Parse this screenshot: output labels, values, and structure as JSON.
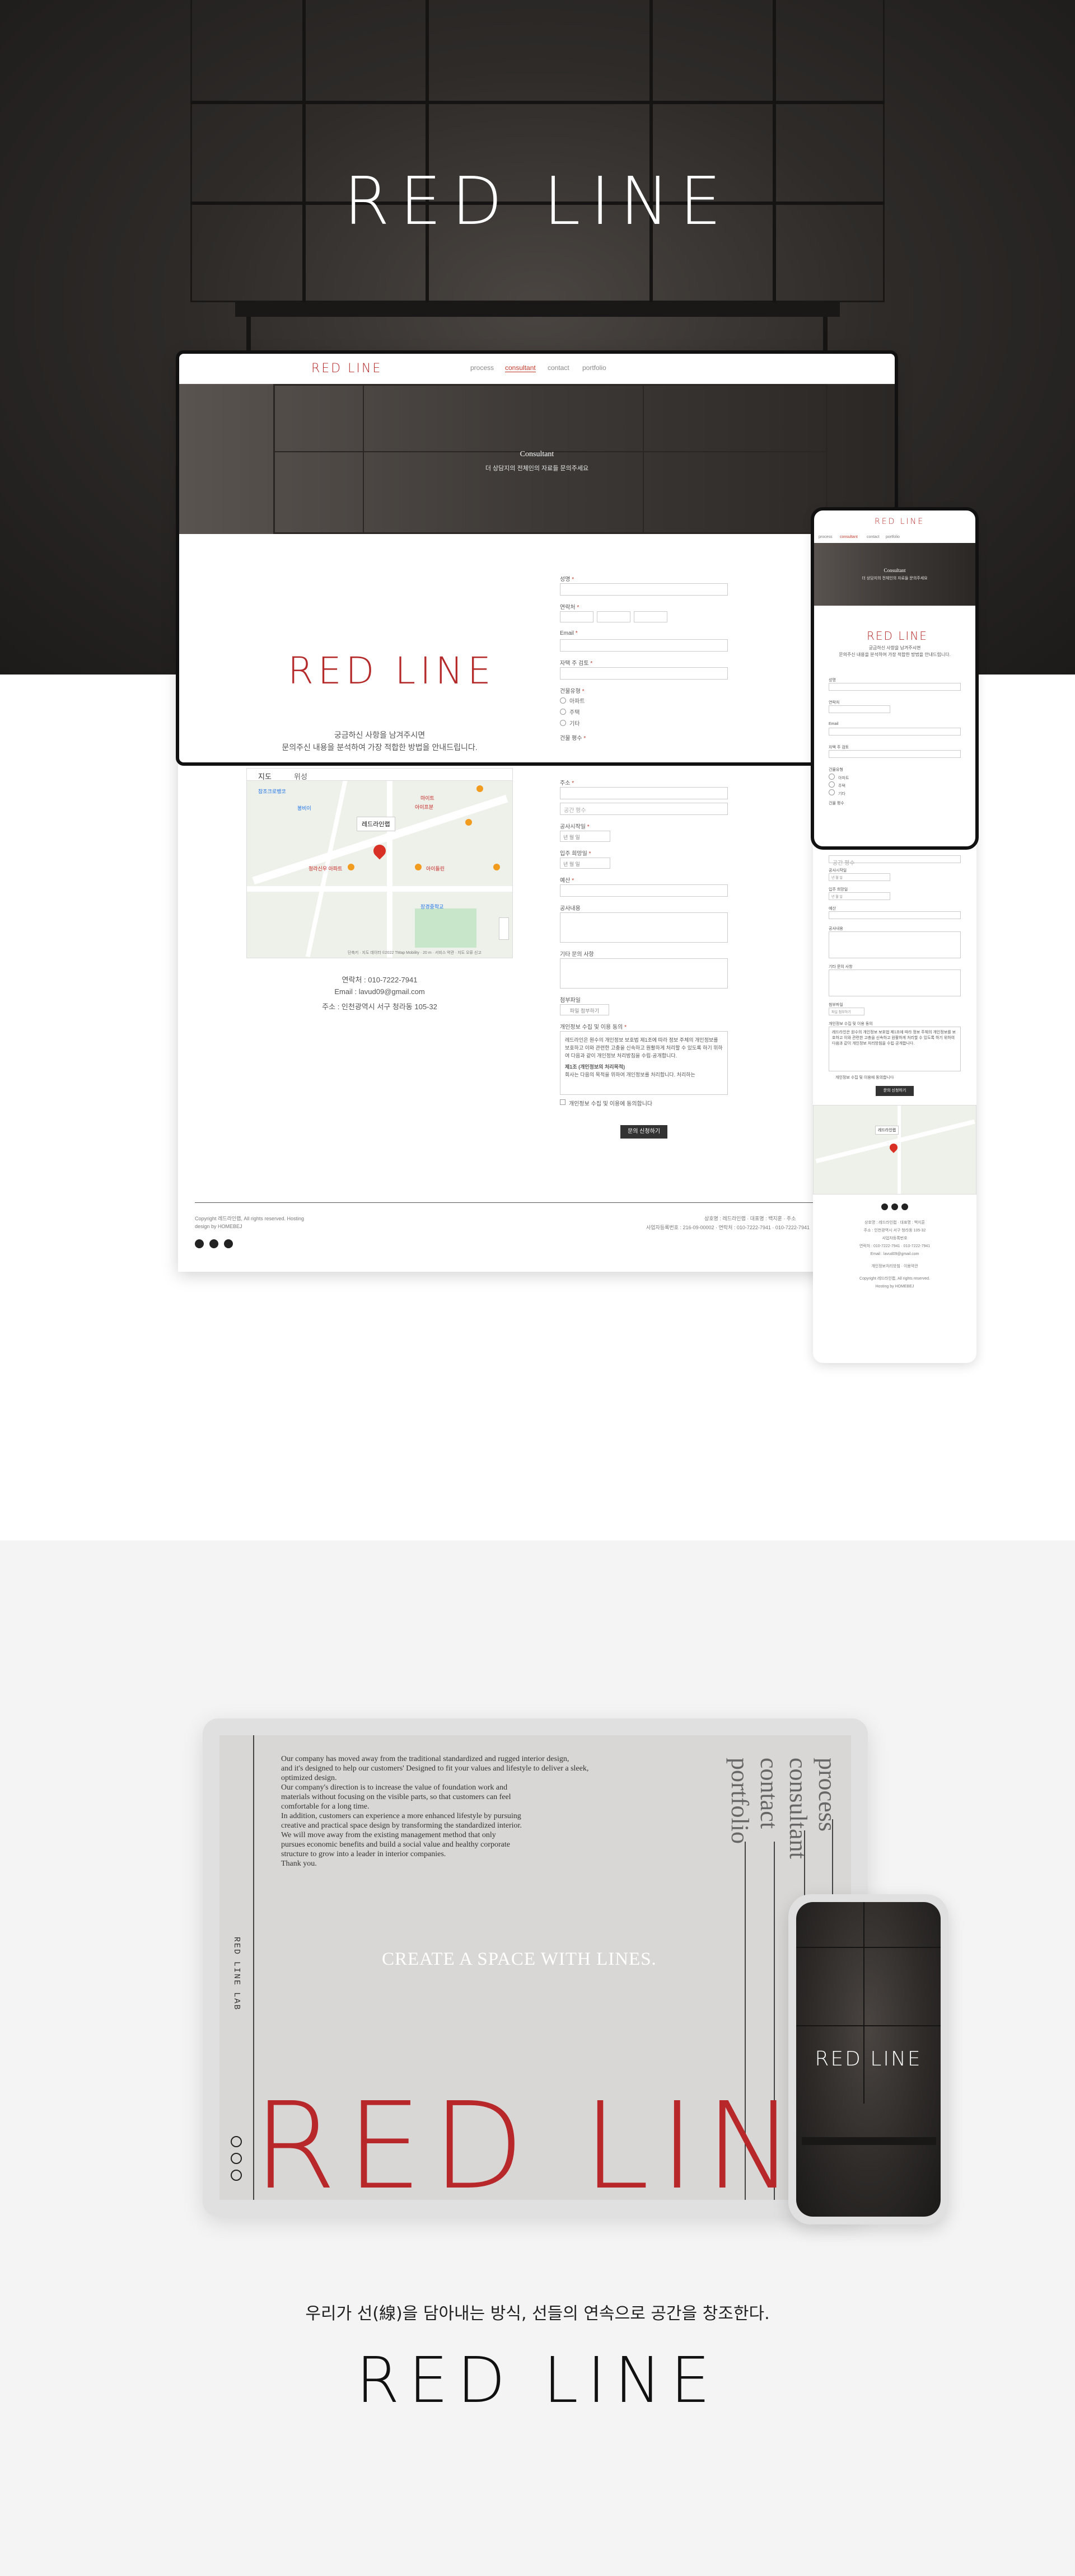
{
  "brand": {
    "logo_text": "RED LINE",
    "accent_color": "#b52a2a"
  },
  "nav": {
    "items": [
      "process",
      "consultant",
      "contact",
      "portfolio"
    ],
    "active": "consultant"
  },
  "banner": {
    "title": "Consultant",
    "subtitle": "더 상담지의 전체인의 자료들 문의주세요"
  },
  "intro": {
    "line1": "궁금하신 사항을 남겨주시면",
    "line2": "문의주신 내용을 분석하여 가장 적합한 방법을 안내드립니다."
  },
  "form": {
    "name_label": "성명",
    "phone_label": "연락처",
    "email_label": "Email",
    "address_label": "자택 주 검토",
    "type_label": "건물유형",
    "type_options": [
      "아파트",
      "주택",
      "기타"
    ],
    "area_label": "건물 평수",
    "size_label": "주소",
    "size_placeholder": "공간 평수",
    "start_label": "공사시작일",
    "start_select": "년 월 일",
    "move_label": "입주 희망일",
    "move_select": "년 월 일",
    "budget_label": "예산",
    "request_label": "공사내용",
    "other_label": "기타 문의 사항",
    "attach_label": "첨부파일",
    "attach_button": "파일 첨부하기",
    "privacy_label": "개인정보 수집 및 이용 동의",
    "privacy_text": "레드라인은 원수의 개인정보 보호법 제1조에 따라 정보 주체의 개인정보를 보호하고 이와 관련한 고충을 신속하고 원활하게 처리할 수 있도록 하기 위하여 다음과 같이 개인정보 처리방침을 수립·공개합니다.",
    "privacy_sub": "제1조 (개인정보의 처리목적)",
    "privacy_sub_text": "회사는 다음의 목적을 위하여 개인정보를 처리합니다. 처리하는",
    "agree_label": "개인정보 수집 및 이용에 동의합니다",
    "submit": "문의 신청하기",
    "required_mark": "*"
  },
  "map": {
    "tabs": [
      "지도",
      "위성"
    ],
    "marker_label": "레드라인랩",
    "place_labels": [
      "참조크로뱅코",
      "봉비이",
      "올팬티일",
      "마이트",
      "아이프분",
      "아이 금강정",
      "청라신우 아파트",
      "아이들린",
      "도보서다",
      "장경중학교",
      "유스파크 청라",
      "운영군서"
    ],
    "footer": "단축키 · 지도 데이터 ©2022 TMap Mobility · 20 m · 서비스 약관 · 지도 오류 신고"
  },
  "contact": {
    "phone_label": "연락처",
    "phone": "010-7222-7941",
    "email_label": "Email",
    "email": "lavud09@gmail.com",
    "address_label": "주소",
    "address": "인천광역시 서구 청라동 105-32"
  },
  "footer": {
    "copyright": "Copyright 레드라인랩, All rights reserved. Hosting",
    "designed": "design by HOMEBEJ",
    "company_links": "상호명 : 레드라인랩 · 대표명 : 백지훈 · 주소",
    "business": "사업자등록번호 : 216-09-00002 · 연락처 : 010-7222-7941 · 010-7222-7941",
    "mobile_lines": [
      "상호명 : 레드라인랩 · 대표명 : 백지훈",
      "주소 : 인천광역시 서구 청라동 105-32",
      "사업자등록번호",
      "연락처 : 010-7222-7941 · 010-7222-7941",
      "Email : lavud09@gmail.com",
      "개인정보처리방침 · 이용약관",
      "Copyright 레드라인랩, All rights reserved.",
      "Hosting by HOMEBEJ"
    ]
  },
  "portfolio": {
    "paragraph": [
      "Our company has moved away from the traditional standardized and rugged interior design,",
      "and it's designed to help our customers' Designed to fit your values and lifestyle to deliver a sleek,",
      "optimized design.",
      "Our company's direction is to increase the value of foundation work and",
      "materials without focusing on the visible parts, so that customers can feel",
      "comfortable for a long time.",
      "In addition, customers can experience a more enhanced lifestyle by pursuing",
      "creative and practical space design by transforming the standardized interior.",
      "We will move away from the existing management method that only",
      "pursues economic benefits and build a social value and healthy corporate",
      "structure to grow into a leader in interior companies.",
      "Thank you."
    ],
    "menu": [
      "process",
      "consultant",
      "contact",
      "portfolio"
    ],
    "side_label": "RED LINE LAB",
    "tagline": "CREATE A SPACE WITH LINES.",
    "big_logo": "RED LINE",
    "phone_logo": "RED LINE"
  },
  "closing": {
    "slogan": "우리가 선(線)을 담아내는 방식, 선들의 연속으로 공간을 창조한다.",
    "logo": "RED LINE"
  }
}
